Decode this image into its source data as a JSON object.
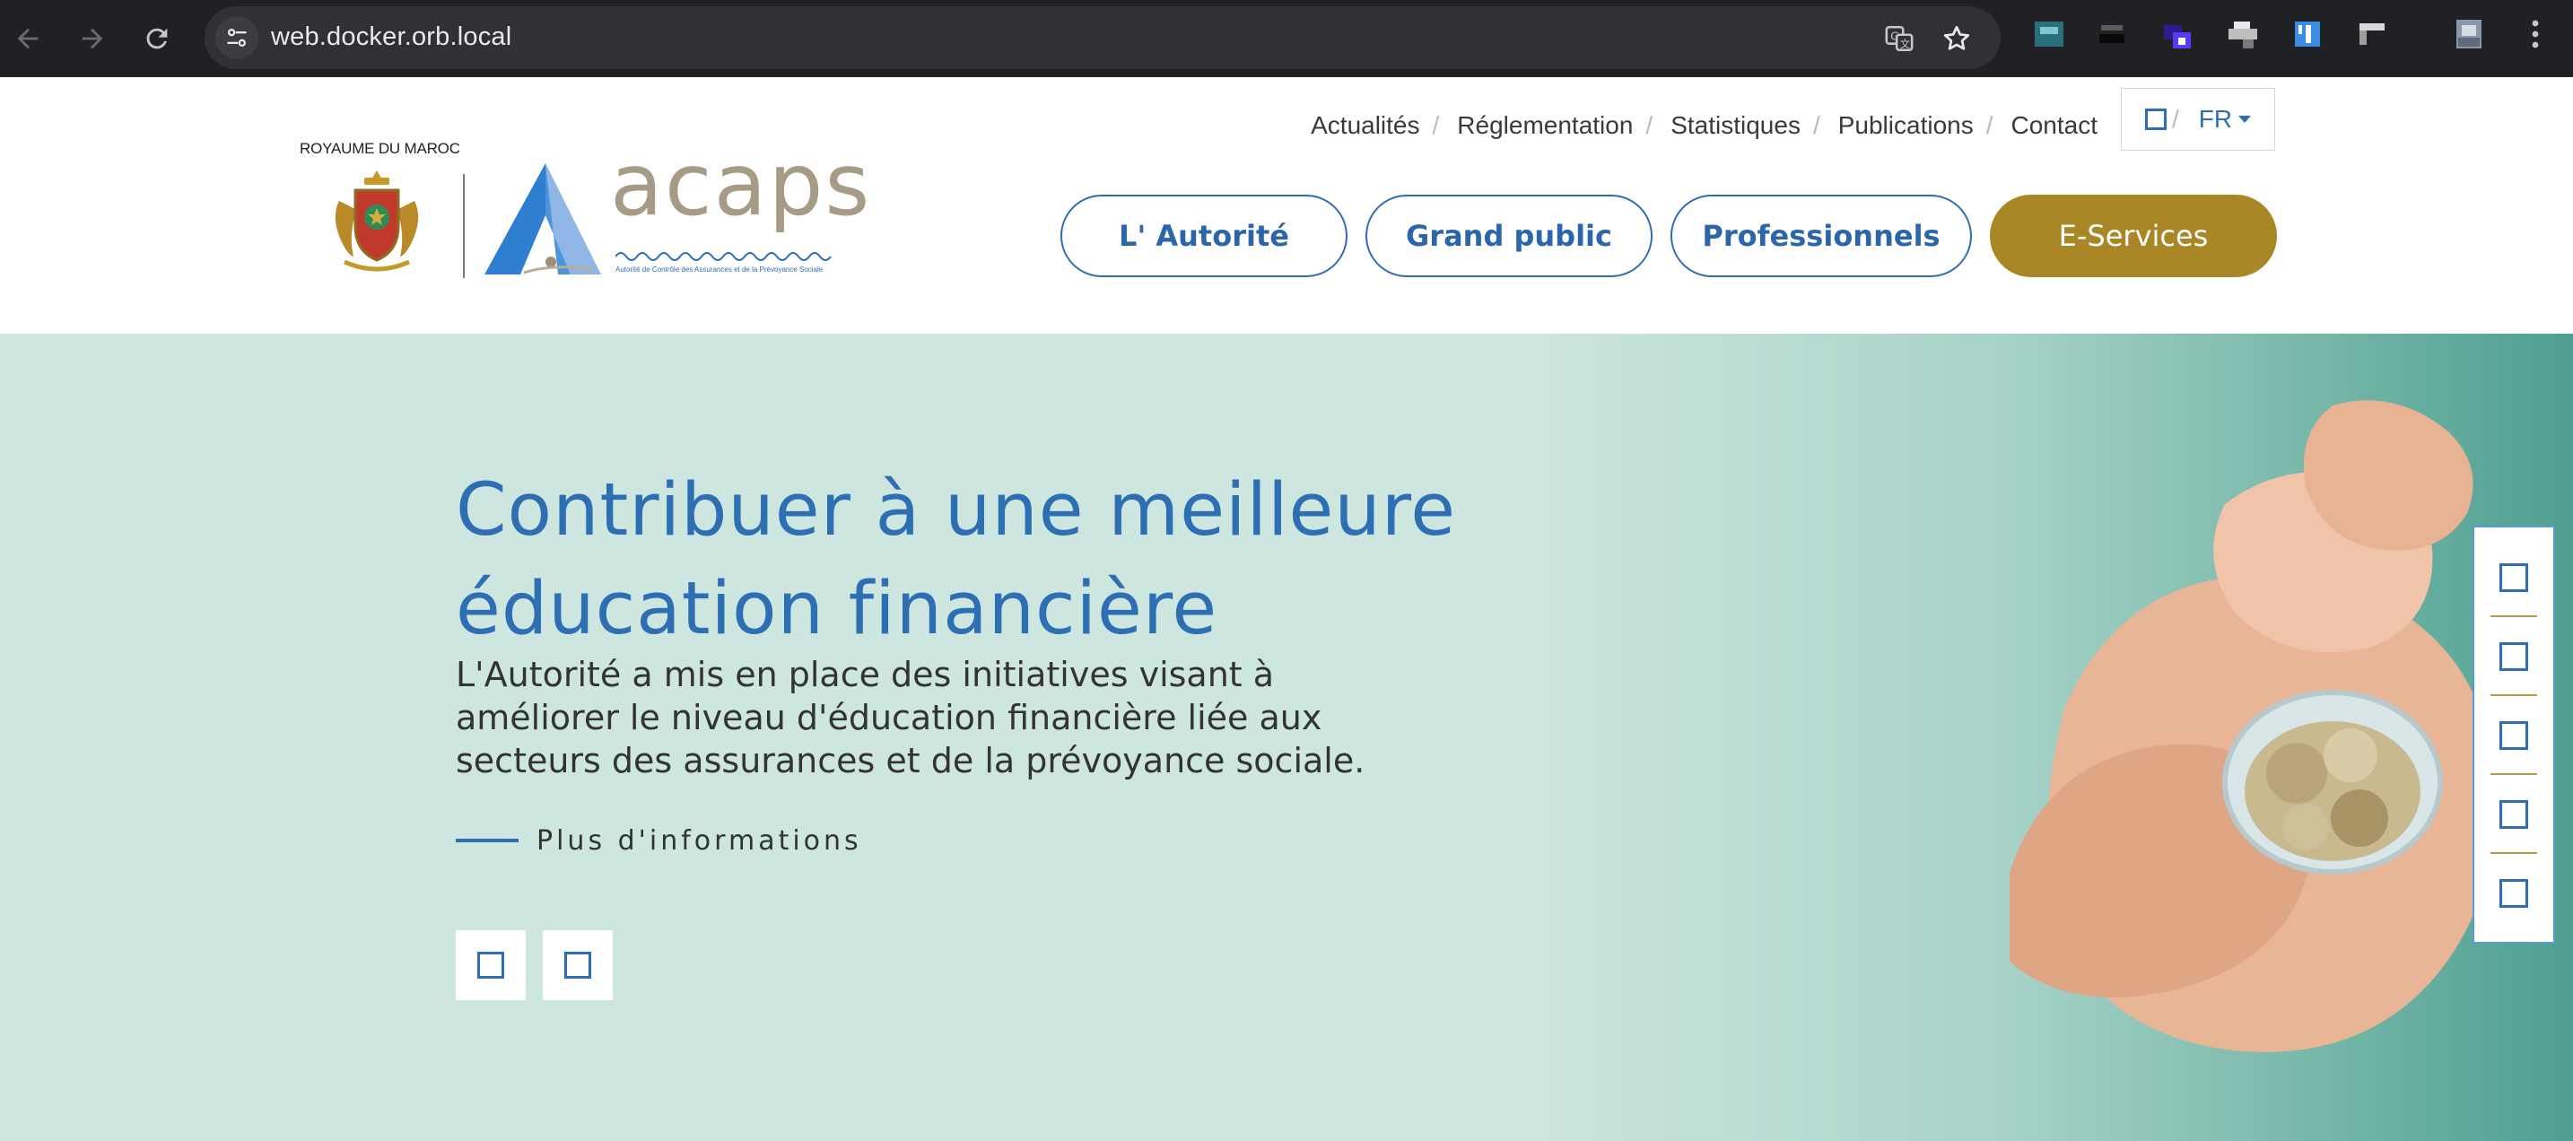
{
  "browser": {
    "url": "web.docker.orb.local"
  },
  "header": {
    "royaume": "ROYAUME DU MAROC",
    "brand": "acaps",
    "brand_subtitle": "Autorité de Contrôle des Assurances et de la Prévoyance Sociale",
    "top_links": [
      "Actualités",
      "Réglementation",
      "Statistiques",
      "Publications",
      "Contact"
    ],
    "separator": "/",
    "language": "FR",
    "main_nav": [
      "L' Autorité",
      "Grand public",
      "Professionnels",
      "E-Services"
    ]
  },
  "hero": {
    "title_lines": [
      "Contribuer à une meilleure",
      "éducation financière"
    ],
    "description_lines": [
      "L'Autorité a mis en place des initiatives visant à",
      "améliorer le niveau d'éducation financière liée aux",
      "secteurs des assurances et de la prévoyance sociale."
    ],
    "more_link": "Plus d'informations"
  },
  "colors": {
    "brand_blue": "#2e6fb3",
    "gold": "#a98726",
    "hero_bg": "#cde6df",
    "chrome_bg": "#202124"
  },
  "icons": {
    "back": "arrow-left-icon",
    "forward": "arrow-right-icon",
    "reload": "reload-icon",
    "site_settings": "tune-icon",
    "translate": "translate-icon",
    "bookmark": "star-icon",
    "menu": "kebab-menu-icon",
    "placeholder": "square-icon"
  }
}
